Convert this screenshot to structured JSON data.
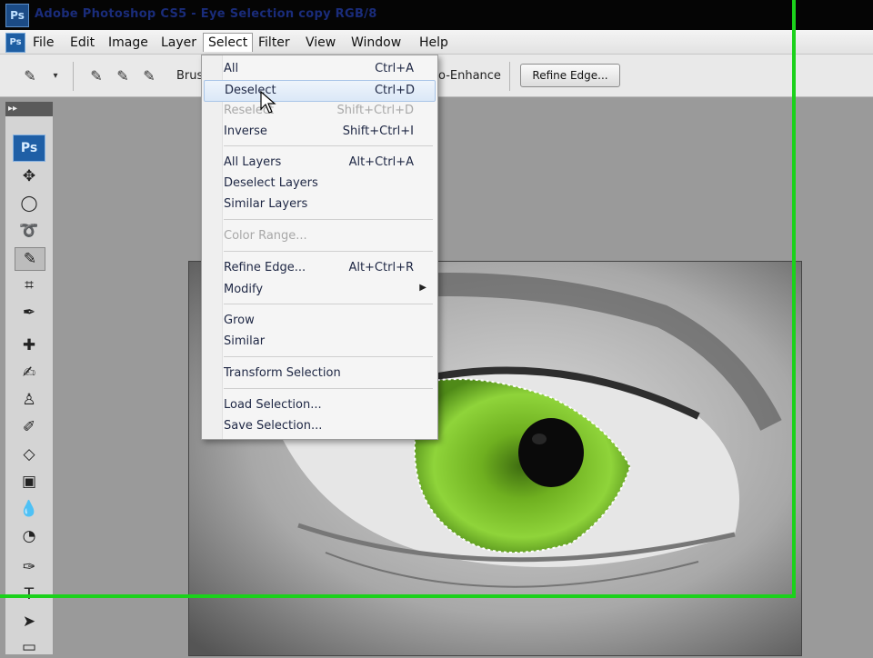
{
  "window": {
    "title": "Adobe Photoshop CS5 - Eye Selection copy RGB/8",
    "app_icon": "Ps"
  },
  "menubar": {
    "app_badge": "Ps",
    "items": [
      "File",
      "Edit",
      "Image",
      "Layer",
      "Select",
      "Filter",
      "View",
      "Window",
      "Help"
    ],
    "active": "Select"
  },
  "options_bar": {
    "brush_label": "Brus",
    "auto_enhance_label": "o-Enhance",
    "refine_edge_button": "Refine Edge..."
  },
  "toolbox": {
    "collapse_label": "▸▸",
    "badge": "Ps"
  },
  "select_menu": {
    "groups": [
      [
        {
          "label": "All",
          "shortcut": "Ctrl+A",
          "enabled": true
        },
        {
          "label": "Deselect",
          "shortcut": "Ctrl+D",
          "enabled": true,
          "highlighted": true
        },
        {
          "label": "Reselect",
          "shortcut": "Shift+Ctrl+D",
          "enabled": false
        },
        {
          "label": "Inverse",
          "shortcut": "Shift+Ctrl+I",
          "enabled": true
        }
      ],
      [
        {
          "label": "All Layers",
          "shortcut": "Alt+Ctrl+A",
          "enabled": true
        },
        {
          "label": "Deselect Layers",
          "shortcut": "",
          "enabled": true
        },
        {
          "label": "Similar Layers",
          "shortcut": "",
          "enabled": true
        }
      ],
      [
        {
          "label": "Color Range...",
          "shortcut": "",
          "enabled": false
        }
      ],
      [
        {
          "label": "Refine Edge...",
          "shortcut": "Alt+Ctrl+R",
          "enabled": true
        },
        {
          "label": "Modify",
          "shortcut": "",
          "enabled": true,
          "submenu": true
        }
      ],
      [
        {
          "label": "Grow",
          "shortcut": "",
          "enabled": true
        },
        {
          "label": "Similar",
          "shortcut": "",
          "enabled": true
        }
      ],
      [
        {
          "label": "Transform Selection",
          "shortcut": "",
          "enabled": true
        }
      ],
      [
        {
          "label": "Load Selection...",
          "shortcut": "",
          "enabled": true
        },
        {
          "label": "Save Selection...",
          "shortcut": "",
          "enabled": true
        }
      ]
    ]
  },
  "colors": {
    "iris": "#7fc12a",
    "highlight_green": "#1bd21b",
    "menu_text": "#1e2744"
  }
}
